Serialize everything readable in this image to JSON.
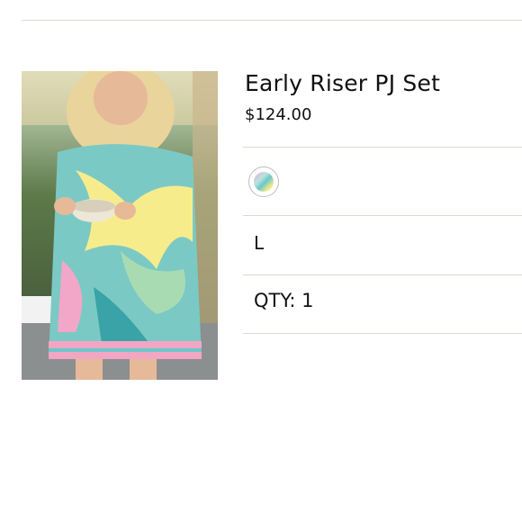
{
  "product": {
    "title": "Early Riser PJ Set",
    "price": "$124.00",
    "image": "product-photo-pj-set",
    "swatch": {
      "icon": "print-swatch-icon",
      "colors": [
        "#f4a9c9",
        "#b9e3e1",
        "#6cc7c9",
        "#f6e98a",
        "#a8d8b0"
      ]
    },
    "size": "L",
    "quantity": "QTY: 1"
  },
  "colors": {
    "divider": "#dcdad0",
    "text": "#111111"
  }
}
